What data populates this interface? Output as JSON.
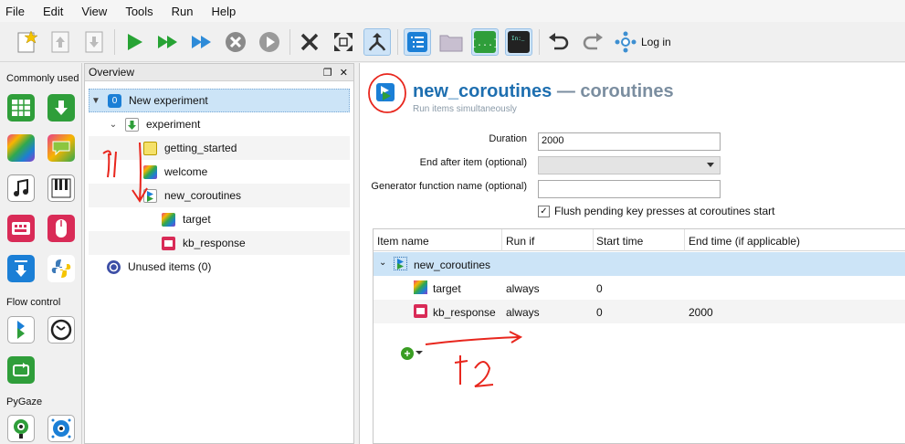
{
  "menu": [
    "File",
    "Edit",
    "View",
    "Tools",
    "Run",
    "Help"
  ],
  "toolbar": {
    "login_label": "Log in",
    "icons": [
      "new-icon",
      "open-icon",
      "save-icon",
      "run-icon",
      "run-fast-icon",
      "run-quick-icon",
      "abort-icon",
      "pause-icon",
      "close-all-icon",
      "fullscreen-icon",
      "merge-icon",
      "overview-icon",
      "file-pool-icon",
      "variables-icon",
      "console-icon",
      "undo-icon",
      "redo-icon",
      "osf-icon"
    ]
  },
  "sidebar": {
    "categories": [
      "Commonly used",
      "Flow control",
      "PyGaze"
    ]
  },
  "overview": {
    "title": "Overview",
    "items": [
      {
        "label": "New experiment",
        "level": 0
      },
      {
        "label": "experiment",
        "level": 1
      },
      {
        "label": "getting_started",
        "level": 2
      },
      {
        "label": "welcome",
        "level": 2
      },
      {
        "label": "new_coroutines",
        "level": 2
      },
      {
        "label": "target",
        "level": 3
      },
      {
        "label": "kb_response",
        "level": 3
      },
      {
        "label": "Unused items (0)",
        "level": 0
      }
    ]
  },
  "item": {
    "name": "new_coroutines",
    "dash": " — ",
    "type": "coroutines",
    "description": "Run items simultaneously",
    "duration_label": "Duration",
    "duration_value": "2000",
    "end_after_label": "End after item (optional)",
    "generator_label": "Generator function name (optional)",
    "generator_value": "",
    "flush_label": "Flush pending key presses at coroutines start"
  },
  "table": {
    "headers": [
      "Item name",
      "Run if",
      "Start time",
      "End time (if applicable)"
    ],
    "root": "new_coroutines",
    "rows": [
      {
        "name": "target",
        "run_if": "always",
        "start": "0",
        "end": ""
      },
      {
        "name": "kb_response",
        "run_if": "always",
        "start": "0",
        "end": "2000"
      }
    ]
  },
  "annotations": {
    "t1": "t1",
    "t2": "t2"
  },
  "colors": {
    "accent": "#1e6fb0",
    "selection": "#cce4f7",
    "annotation": "#e8261d",
    "run": "#27a334",
    "fast": "#2e8bd8"
  }
}
